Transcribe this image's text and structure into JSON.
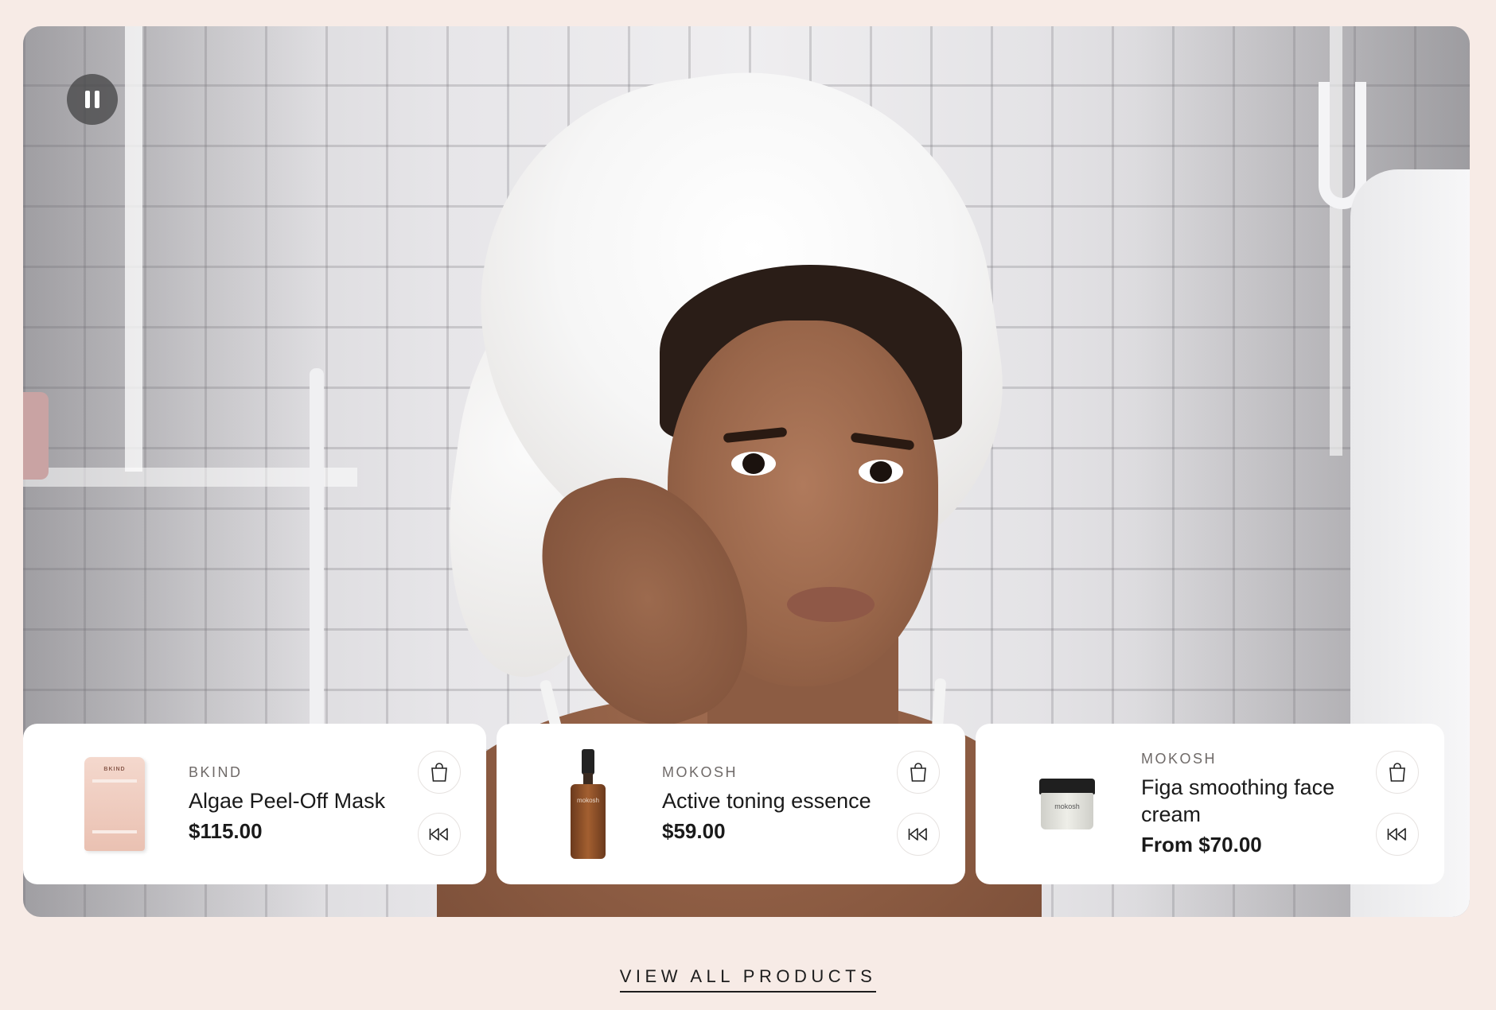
{
  "video": {
    "pause_icon": "pause-icon"
  },
  "products": [
    {
      "brand": "BKIND",
      "name": "Algae Peel-Off Mask",
      "price": "$115.00",
      "thumb_text": "BKIND",
      "bag_icon": "shopping-bag-icon",
      "rewind_icon": "rewind-icon"
    },
    {
      "brand": "MOKOSH",
      "name": "Active toning essence",
      "price": "$59.00",
      "thumb_text": "mokosh",
      "bag_icon": "shopping-bag-icon",
      "rewind_icon": "rewind-icon"
    },
    {
      "brand": "MOKOSH",
      "name": "Figa smoothing face cream",
      "price": "From $70.00",
      "thumb_text": "mokosh",
      "bag_icon": "shopping-bag-icon",
      "rewind_icon": "rewind-icon"
    }
  ],
  "view_all_label": "VIEW ALL PRODUCTS",
  "colors": {
    "page_bg": "#f7ebe6",
    "card_bg": "#ffffff",
    "text": "#1a1a1a",
    "brand_text": "#6f6a68"
  }
}
